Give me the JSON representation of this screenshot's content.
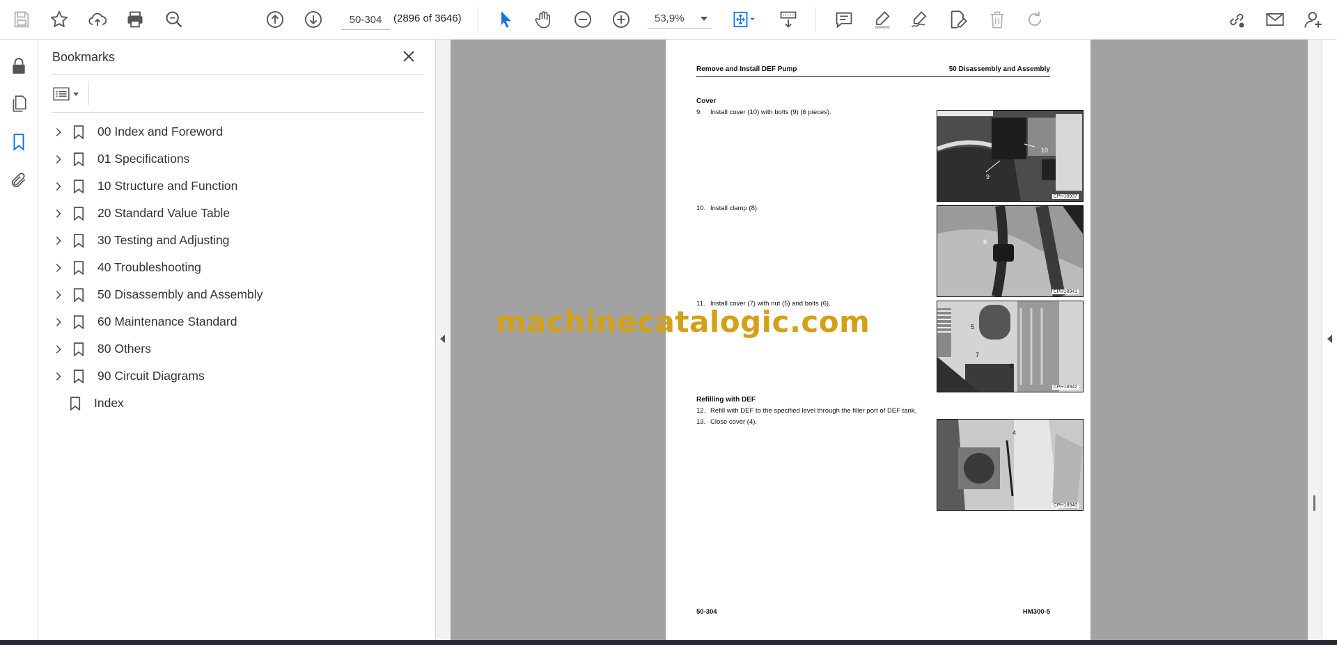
{
  "toolbar": {
    "page_input": "50-304",
    "page_count": "(2896 of 3646)",
    "zoom": "53,9%"
  },
  "bookmarks": {
    "title": "Bookmarks",
    "items": [
      {
        "label": "00 Index and Foreword",
        "expandable": true
      },
      {
        "label": "01 Specifications",
        "expandable": true
      },
      {
        "label": "10 Structure and Function",
        "expandable": true
      },
      {
        "label": "20 Standard Value Table",
        "expandable": true
      },
      {
        "label": "30 Testing and Adjusting",
        "expandable": true
      },
      {
        "label": "40 Troubleshooting",
        "expandable": true
      },
      {
        "label": "50 Disassembly and Assembly",
        "expandable": true
      },
      {
        "label": "60 Maintenance Standard",
        "expandable": true
      },
      {
        "label": "80 Others",
        "expandable": true
      },
      {
        "label": "90 Circuit Diagrams",
        "expandable": true
      },
      {
        "label": "Index",
        "expandable": false
      }
    ]
  },
  "page": {
    "header_left": "Remove and Install DEF Pump",
    "header_right": "50 Disassembly and Assembly",
    "section_cover": "Cover",
    "section_refill": "Refilling with DEF",
    "steps": [
      {
        "num": "9.",
        "text": "Install cover (10) with bolts (9) (6 pieces)."
      },
      {
        "num": "10.",
        "text": "Install clamp (8)."
      },
      {
        "num": "11.",
        "text": "Install cover (7) with nut (5) and bolts (6)."
      },
      {
        "num": "12.",
        "text": "Refill with DEF to the specified level through the filler port of DEF tank."
      },
      {
        "num": "13.",
        "text": "Close cover (4)."
      }
    ],
    "figures": [
      {
        "code": "CPH18937",
        "callouts": [
          "10",
          "9"
        ]
      },
      {
        "code": "CPH18941",
        "callouts": [
          "8"
        ]
      },
      {
        "code": "CPH18942",
        "callouts": [
          "5",
          "7",
          "6"
        ]
      },
      {
        "code": "CPH18940",
        "callouts": [
          "4"
        ]
      }
    ],
    "footer_left": "50-304",
    "footer_right": "HM300-5"
  },
  "watermark": "machinecatalogic.com",
  "colors": {
    "accent_blue": "#1473e6",
    "doc_background": "#a2a2a2",
    "watermark": "#d4a017"
  }
}
